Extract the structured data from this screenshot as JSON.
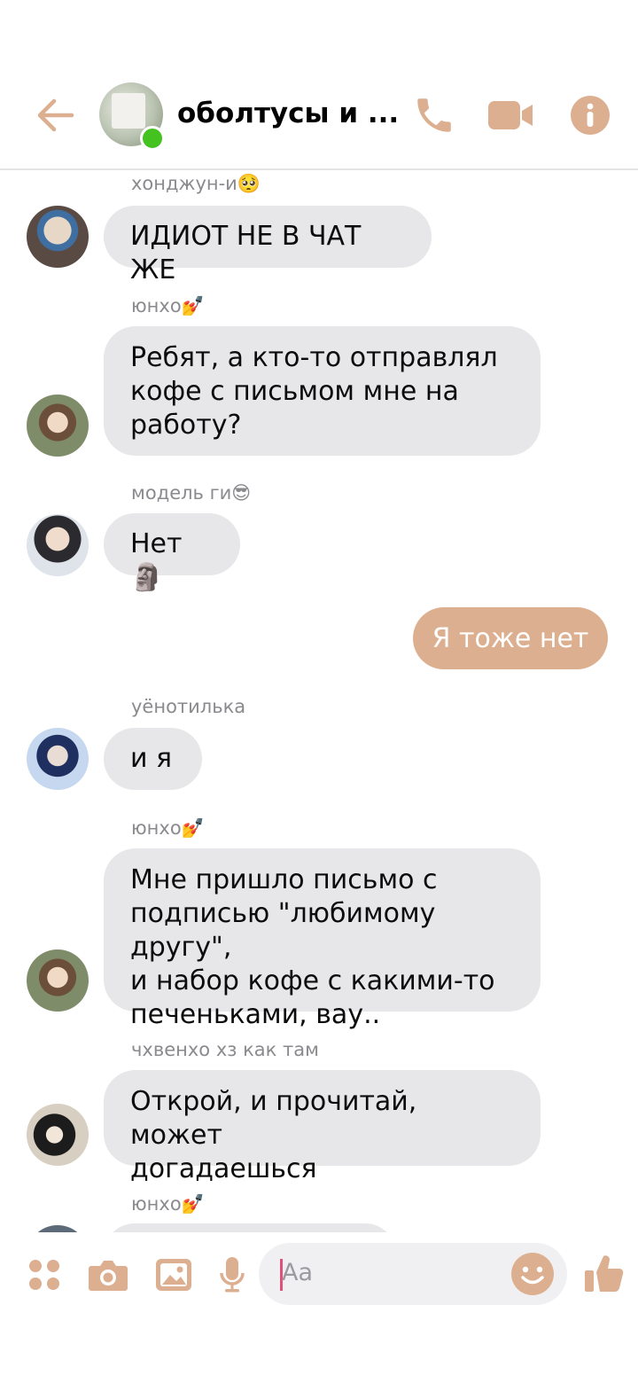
{
  "header": {
    "title": "оболтусы и ...",
    "accent": "#dcaf91"
  },
  "messages": [
    {
      "sender": "хонджун-и🥺",
      "text": "ИДИОТ НЕ В ЧАТ ЖЕ"
    },
    {
      "sender": "юнхо💅",
      "text": "Ребят, а кто-то отправлял\nкофе с письмом мне на\nработу?"
    },
    {
      "sender": "модель ги😎",
      "text": "Нет🗿"
    },
    {
      "sender": "",
      "text": "Я тоже нет",
      "outgoing": true
    },
    {
      "sender": "уёнотилька",
      "text": "и я"
    },
    {
      "sender": "юнхо💅",
      "text": "Мне пришло письмо с\nподписью \"любимому другу\",\nи набор кофе с какими-то\nпеченьками, вау.."
    },
    {
      "sender": "чхвенхо хз как там",
      "text": "Открой, и прочитай, может\nдогадаешься"
    },
    {
      "sender": "юнхо💅",
      "text": ""
    }
  ],
  "composer": {
    "placeholder": "Aa"
  },
  "icons": {
    "back": "back-arrow-icon",
    "call": "phone-icon",
    "video": "video-camera-icon",
    "info": "info-icon",
    "apps": "apps-grid-icon",
    "camera": "camera-icon",
    "gallery": "image-icon",
    "voice": "microphone-icon",
    "emoji": "emoji-icon",
    "like": "thumbs-up-icon"
  }
}
